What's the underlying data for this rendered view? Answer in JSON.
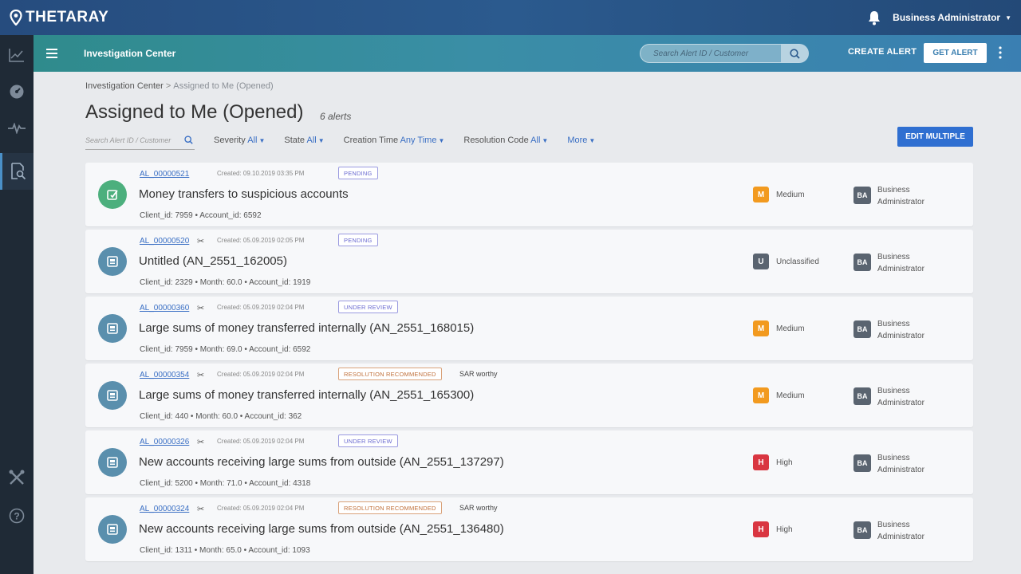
{
  "app": {
    "logo_text": "THETARAY",
    "user_name": "Business Administrator"
  },
  "subbar": {
    "title": "Investigation Center",
    "search_placeholder": "Search Alert ID / Customer",
    "create_alert_label": "CREATE ALERT",
    "get_alert_label": "GET ALERT"
  },
  "rail": {
    "items": [
      "analytics-chart-icon",
      "dashboard-gauge-icon",
      "pulse-icon",
      "investigation-icon",
      "tools-icon",
      "help-icon"
    ]
  },
  "breadcrumb": {
    "root": "Investigation Center",
    "separator": ">",
    "current": "Assigned to Me (Opened)"
  },
  "page": {
    "title": "Assigned to Me (Opened)",
    "count": "6 alerts"
  },
  "filters": {
    "search_placeholder": "Search Alert ID / Customer",
    "severity": {
      "label": "Severity",
      "value": "All"
    },
    "state": {
      "label": "State",
      "value": "All"
    },
    "creation_time": {
      "label": "Creation Time",
      "value": "Any Time"
    },
    "resolution_code": {
      "label": "Resolution Code",
      "value": "All"
    },
    "more": {
      "label": "More"
    },
    "edit_multiple_label": "EDIT MULTIPLE"
  },
  "colors": {
    "medium": "#f29a1f",
    "high": "#d93641",
    "unclassified": "#5a6470",
    "icon_green": "#4caf7d",
    "icon_blue": "#5a8fad"
  },
  "alerts": [
    {
      "id": "AL_00000521",
      "flag": "",
      "created": "Created: 09.10.2019 03:35 PM",
      "status": "PENDING",
      "extra_tag": "",
      "title": "Money transfers to suspicious accounts",
      "details": "Client_id: 7959  •  Account_id: 6592",
      "severity_letter": "M",
      "severity_label": "Medium",
      "assignee_initials": "BA",
      "assignee_name": "Business Administrator"
    },
    {
      "id": "AL_00000520",
      "flag": "✂",
      "created": "Created: 05.09.2019 02:05 PM",
      "status": "PENDING",
      "extra_tag": "",
      "title": "Untitled (AN_2551_162005)",
      "details": "Client_id: 2329  •  Month: 60.0  •  Account_id: 1919",
      "severity_letter": "U",
      "severity_label": "Unclassified",
      "assignee_initials": "BA",
      "assignee_name": "Business Administrator"
    },
    {
      "id": "AL_00000360",
      "flag": "✂",
      "created": "Created: 05.09.2019 02:04 PM",
      "status": "UNDER REVIEW",
      "extra_tag": "",
      "title": "Large sums of money transferred internally (AN_2551_168015)",
      "details": "Client_id: 7959  •  Month: 69.0  •  Account_id: 6592",
      "severity_letter": "M",
      "severity_label": "Medium",
      "assignee_initials": "BA",
      "assignee_name": "Business Administrator"
    },
    {
      "id": "AL_00000354",
      "flag": "✂",
      "created": "Created: 05.09.2019 02:04 PM",
      "status": "RESOLUTION RECOMMENDED",
      "extra_tag": "SAR worthy",
      "title": "Large sums of money transferred internally (AN_2551_165300)",
      "details": "Client_id: 440  •  Month: 60.0  •  Account_id: 362",
      "severity_letter": "M",
      "severity_label": "Medium",
      "assignee_initials": "BA",
      "assignee_name": "Business Administrator"
    },
    {
      "id": "AL_00000326",
      "flag": "✂",
      "created": "Created: 05.09.2019 02:04 PM",
      "status": "UNDER REVIEW",
      "extra_tag": "",
      "title": "New accounts receiving large sums from outside (AN_2551_137297)",
      "details": "Client_id: 5200  •  Month: 71.0  •  Account_id: 4318",
      "severity_letter": "H",
      "severity_label": "High",
      "assignee_initials": "BA",
      "assignee_name": "Business Administrator"
    },
    {
      "id": "AL_00000324",
      "flag": "✂",
      "created": "Created: 05.09.2019 02:04 PM",
      "status": "RESOLUTION RECOMMENDED",
      "extra_tag": "SAR worthy",
      "title": "New accounts receiving large sums from outside (AN_2551_136480)",
      "details": "Client_id: 1311  •  Month: 65.0  •  Account_id: 1093",
      "severity_letter": "H",
      "severity_label": "High",
      "assignee_initials": "BA",
      "assignee_name": "Business Administrator"
    }
  ]
}
